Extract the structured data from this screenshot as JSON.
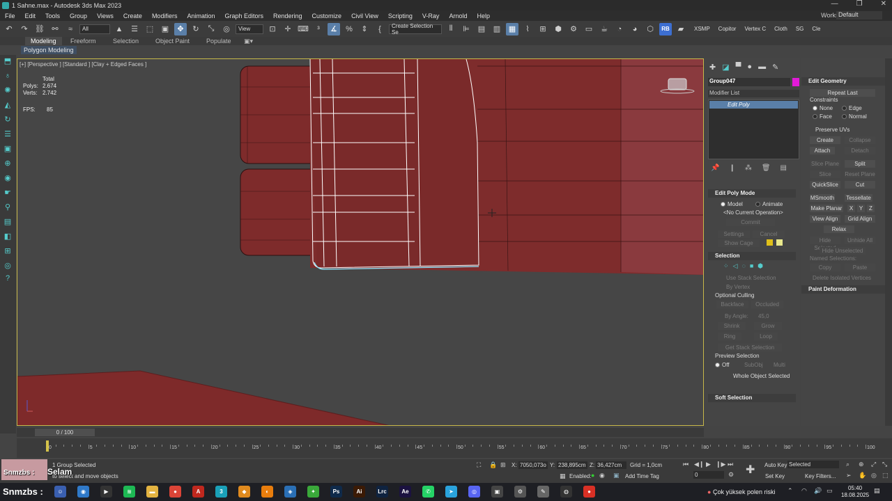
{
  "window": {
    "title": "1 Sahne.max - Autodesk 3ds Max 2023",
    "controls": [
      "—",
      "❐",
      "✕"
    ]
  },
  "menu": {
    "items": [
      "File",
      "Edit",
      "Tools",
      "Group",
      "Views",
      "Create",
      "Modifiers",
      "Animation",
      "Graph Editors",
      "Rendering",
      "Customize",
      "Civil View",
      "Scripting",
      "V-Ray",
      "Arnold",
      "Help"
    ],
    "workspaces_label": "Workspaces:",
    "workspaces_value": "Default"
  },
  "toolbar": {
    "selection_filter": "All",
    "ref_coord": "View",
    "named_selection": "Create Selection Se",
    "rb_label": "RB",
    "xsmp": "XSMP",
    "copitor": "Copitor",
    "vertex": "Vertex C",
    "cloth": "Cloth",
    "sg": "SG",
    "cle": "Cle"
  },
  "ribbon": {
    "tabs": [
      "Modeling",
      "Freeform",
      "Selection",
      "Object Paint",
      "Populate"
    ],
    "active": "Modeling",
    "sub_label": "Polygon Modeling"
  },
  "viewport": {
    "label": "[+] [Perspective ] [Standard ] [Clay + Edged Faces ]",
    "stats": {
      "header": "Total",
      "polys_label": "Polys:",
      "polys": "2.674",
      "verts_label": "Verts:",
      "verts": "2.742",
      "fps_label": "FPS:",
      "fps": "85"
    }
  },
  "command_panel": {
    "object_name": "Group047",
    "object_color": "#e21ad8",
    "modifier_list": "Modifier List",
    "stack_item": "Edit Poly",
    "edit_poly_mode": {
      "header": "Edit Poly Mode",
      "model": "Model",
      "animate": "Animate",
      "operation": "<No Current Operation>",
      "commit": "Commit",
      "settings": "Settings",
      "cancel": "Cancel",
      "show_cage": "Show Cage"
    },
    "selection": {
      "header": "Selection",
      "use_stack": "Use Stack Selection",
      "by_vertex": "By Vertex",
      "optional_culling": "Optional Culling",
      "backface": "Backface",
      "occluded": "Occluded",
      "by_angle": "By Angle:",
      "angle_value": "45,0",
      "shrink": "Shrink",
      "grow": "Grow",
      "ring": "Ring",
      "loop": "Loop",
      "get_stack": "Get Stack Selection",
      "preview": "Preview Selection",
      "off": "Off",
      "subobj": "SubObj",
      "multi": "Multi",
      "whole": "Whole Object Selected"
    },
    "soft_selection": "Soft Selection"
  },
  "edit_geometry": {
    "header": "Edit Geometry",
    "repeat_last": "Repeat Last",
    "constraints": "Constraints",
    "none": "None",
    "edge": "Edge",
    "face": "Face",
    "normal": "Normal",
    "preserve_uvs": "Preserve UVs",
    "create": "Create",
    "collapse": "Collapse",
    "attach": "Attach",
    "detach": "Detach",
    "slice_plane": "Slice Plane",
    "split": "Split",
    "slice": "Slice",
    "reset_plane": "Reset Plane",
    "quickslice": "QuickSlice",
    "cut": "Cut",
    "msmooth": "MSmooth",
    "tessellate": "Tessellate",
    "make_planar": "Make Planar",
    "x": "X",
    "y": "Y",
    "z": "Z",
    "view_align": "View Align",
    "grid_align": "Grid Align",
    "relax": "Relax",
    "hide_selected": "Hide Selected",
    "unhide_all": "Unhide All",
    "hide_unselected": "Hide Unselected",
    "named_selections": "Named Selections:",
    "copy": "Copy",
    "paste": "Paste",
    "delete_isolated": "Delete Isolated Vertices",
    "paint_deformation": "Paint Deformation"
  },
  "timeline": {
    "slider": "0 / 100",
    "ticks": [
      "0",
      "5",
      "10",
      "15",
      "20",
      "25",
      "30",
      "35",
      "40",
      "45",
      "50",
      "55",
      "60",
      "65",
      "70",
      "75",
      "80",
      "85",
      "90",
      "95",
      "100"
    ]
  },
  "status": {
    "selection_msg": "1 Group Selected",
    "prompt": "to select and move objects",
    "x_label": "X:",
    "x": "7050,073o",
    "y_label": "Y:",
    "y": "238,895cm",
    "z_label": "Z:",
    "z": "36,427cm",
    "grid": "Grid = 1,0cm",
    "enabled": "Enabled:",
    "add_time_tag": "Add Time Tag",
    "auto_key": "Auto Key",
    "selected": "Selected",
    "set_key": "Set Key",
    "key_filters": "Key Filters...",
    "frame": "0"
  },
  "overlay": {
    "snm1": "Snmzbs :",
    "selam": "Selam",
    "snm2": "Snmzbs :"
  },
  "taskbar": {
    "weather": "Çok yüksek polen riski",
    "time": "05:40",
    "date": "18.08.2025",
    "apps": [
      {
        "name": "finder-app",
        "label": "☺",
        "color": "#3a5fb0"
      },
      {
        "name": "chrome-like-app",
        "label": "◉",
        "color": "#2f79c9"
      },
      {
        "name": "media-player-app",
        "label": "▶",
        "color": "#333"
      },
      {
        "name": "spotify-app",
        "label": "≋",
        "color": "#1db954"
      },
      {
        "name": "file-explorer-app",
        "label": "▬",
        "color": "#e3b341"
      },
      {
        "name": "chrome-app",
        "label": "●",
        "color": "#db4437"
      },
      {
        "name": "acrobat-app",
        "label": "A",
        "color": "#c0281e"
      },
      {
        "name": "3dsmax-app",
        "label": "3",
        "color": "#1aa0b8"
      },
      {
        "name": "box-app",
        "label": "◆",
        "color": "#e08a1e"
      },
      {
        "name": "blender-app",
        "label": "◐",
        "color": "#e87d0d"
      },
      {
        "name": "security-app",
        "label": "◈",
        "color": "#2a6fb5"
      },
      {
        "name": "leaf-app",
        "label": "✦",
        "color": "#3aa83a"
      },
      {
        "name": "photoshop-app",
        "label": "Ps",
        "color": "#0f2a4a"
      },
      {
        "name": "illustrator-app",
        "label": "Ai",
        "color": "#3b1a05"
      },
      {
        "name": "lightroom-app",
        "label": "Lrc",
        "color": "#0f2340"
      },
      {
        "name": "after-effects-app",
        "label": "Ae",
        "color": "#1b1240"
      },
      {
        "name": "whatsapp-app",
        "label": "✆",
        "color": "#25d366"
      },
      {
        "name": "telegram-app",
        "label": "➤",
        "color": "#2aa3dd"
      },
      {
        "name": "discord-app",
        "label": "◎",
        "color": "#5865f2"
      },
      {
        "name": "monitor-app",
        "label": "▣",
        "color": "#444"
      },
      {
        "name": "settings-app",
        "label": "⚙",
        "color": "#555"
      },
      {
        "name": "tool-app",
        "label": "✎",
        "color": "#666"
      },
      {
        "name": "record-app",
        "label": "◍",
        "color": "#333"
      },
      {
        "name": "red-app",
        "label": "●",
        "color": "#d93025"
      }
    ]
  }
}
